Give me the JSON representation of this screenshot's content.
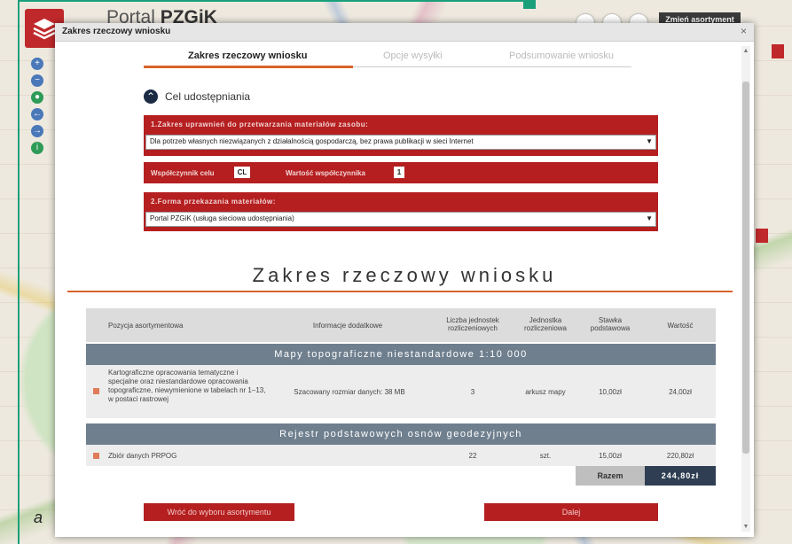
{
  "portal": {
    "title_prefix": "Portal ",
    "title_strong": "PZGiK",
    "change_btn": "Zmień asortyment"
  },
  "dialog": {
    "title": "Zakres rzeczowy wniosku",
    "close": "×"
  },
  "steps": [
    {
      "label": "Zakres rzeczowy wniosku",
      "active": true
    },
    {
      "label": "Opcje wysyłki",
      "active": false
    },
    {
      "label": "Podsumowanie wniosku",
      "active": false
    }
  ],
  "cel": {
    "label": "Cel udostępniania"
  },
  "panel1": {
    "label": "1.Zakres uprawnień do przetwarzania materiałów zasobu:",
    "value": "Dla potrzeb własnych niezwiązanych z działalnością gospodarczą, bez prawa publikacji w sieci Internet"
  },
  "coef": {
    "label1": "Współczynnik celu",
    "value1": "CL",
    "label2": "Wartość współczynnika",
    "value2": "1"
  },
  "panel2": {
    "label": "2.Forma przekazania materiałów:",
    "value": "Portal PZGiK (usługa sieciowa udostępniania)"
  },
  "section": {
    "title": "Zakres rzeczowy wniosku"
  },
  "table": {
    "headers": {
      "pos": "Pozycja asortymentowa",
      "info": "Informacje dodatkowe",
      "units_count": "Liczba jednostek rozliczeniowych",
      "unit": "Jednostka rozliczeniowa",
      "rate": "Stawka podstawowa",
      "value": "Wartość"
    },
    "group1": "Mapy topograficzne niestandardowe 1:10 000",
    "row1": {
      "pos": "Kartograficzne opracowania tematyczne i specjalne oraz niestandardowe opracowania topograficzne, niewymienione w tabelach nr 1–13, w postaci rastrowej",
      "info": "Szacowany rozmiar danych: 38 MB",
      "count": "3",
      "unit": "arkusz mapy",
      "rate": "10,00zł",
      "value": "24,00zł"
    },
    "group2": "Rejestr podstawowych osnów geodezyjnych",
    "row2": {
      "pos": "Zbiór danych PRPOG",
      "info": "",
      "count": "22",
      "unit": "szt.",
      "rate": "15,00zł",
      "value": "220,80zł"
    },
    "total_label": "Razem",
    "total_value": "244,80zł"
  },
  "buttons": {
    "back": "Wróć do wyboru asortymentu",
    "next": "Dalej"
  },
  "corner_label": "a",
  "colors": {
    "accent_red": "#b51f20",
    "step_orange": "#d9642b",
    "group_gray": "#6f7f8e",
    "total_navy": "#2f3e52",
    "frame_green": "#19a07a"
  }
}
